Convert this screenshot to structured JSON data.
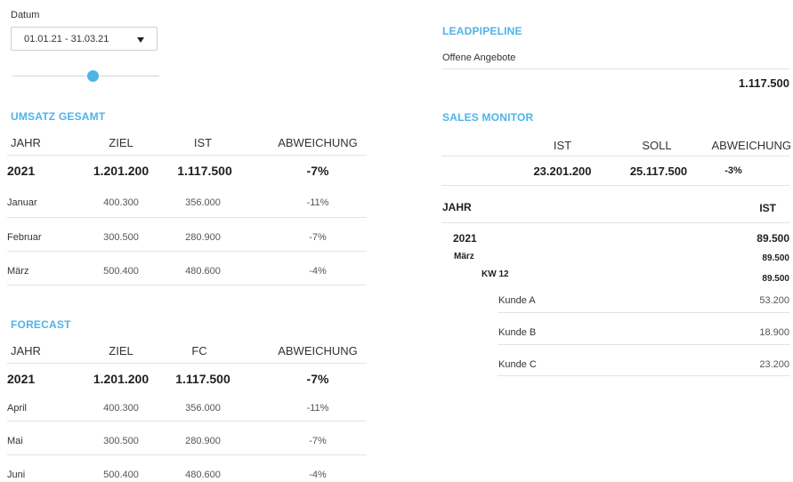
{
  "filter": {
    "date_label": "Datum",
    "date_value": "01.01.21 - 31.03.21",
    "slider_value_fraction": 0.55
  },
  "umsatz": {
    "title": "UMSATZ GESAMT",
    "headers": [
      "JAHR",
      "ZIEL",
      "IST",
      "ABWEICHUNG"
    ],
    "total": {
      "year": "2021",
      "ziel": "1.201.200",
      "ist": "1.117.500",
      "abw": "-7%"
    },
    "rows": [
      {
        "label": "Januar",
        "ziel": "400.300",
        "ist": "356.000",
        "abw": "-11%"
      },
      {
        "label": "Februar",
        "ziel": "300.500",
        "ist": "280.900",
        "abw": "-7%"
      },
      {
        "label": "März",
        "ziel": "500.400",
        "ist": "480.600",
        "abw": "-4%"
      }
    ]
  },
  "forecast": {
    "title": "FORECAST",
    "headers": [
      "JAHR",
      "ZIEL",
      "FC",
      "ABWEICHUNG"
    ],
    "total": {
      "year": "2021",
      "ziel": "1.201.200",
      "fc": "1.117.500",
      "abw": "-7%"
    },
    "rows": [
      {
        "label": "April",
        "ziel": "400.300",
        "fc": "356.000",
        "abw": "-11%"
      },
      {
        "label": "Mai",
        "ziel": "300.500",
        "fc": "280.900",
        "abw": "-7%"
      },
      {
        "label": "Juni",
        "ziel": "500.400",
        "fc": "480.600",
        "abw": "-4%"
      }
    ]
  },
  "leadpipeline": {
    "title": "LEADPIPELINE",
    "label": "Offene Angebote",
    "value": "1.117.500"
  },
  "sales_monitor": {
    "title": "SALES MONITOR",
    "headers": [
      "IST",
      "SOLL",
      "ABWEICHUNG"
    ],
    "values": {
      "ist": "23.201.200",
      "soll": "25.117.500",
      "abw": "-3%"
    },
    "tree_headers": {
      "jahr": "JAHR",
      "ist": "IST"
    },
    "tree": {
      "year": "2021",
      "year_value": "89.500",
      "month": "März",
      "month_value": "89.500",
      "week": "KW 12",
      "week_value": "89.500",
      "customers": [
        {
          "name": "Kunde A",
          "value": "53.200"
        },
        {
          "name": "Kunde B",
          "value": "18.900"
        },
        {
          "name": "Kunde C",
          "value": "23.200"
        }
      ]
    }
  },
  "colors": {
    "accent": "#4fb3e8",
    "divider": "#e3e3e3"
  }
}
